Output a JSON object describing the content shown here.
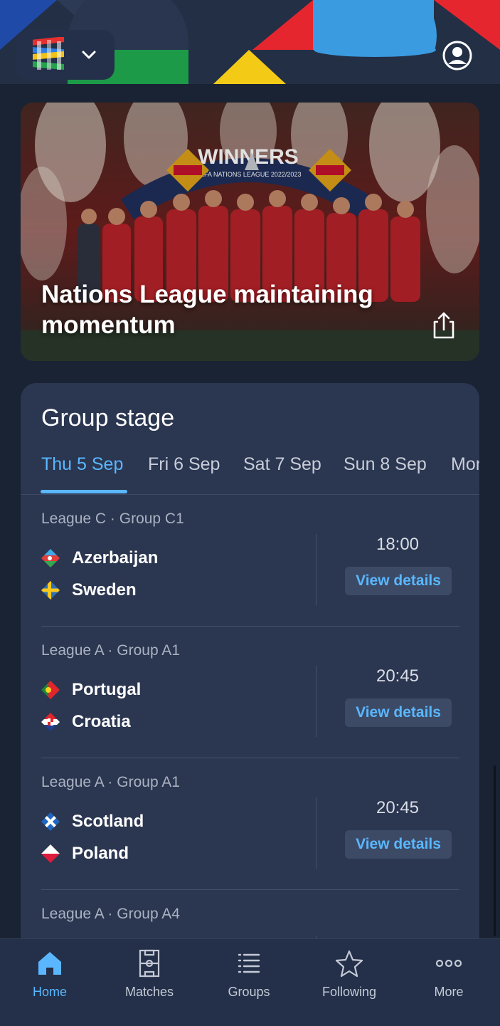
{
  "header": {
    "logo_icon": "nations-league-logo",
    "dropdown_icon": "chevron-down-icon",
    "profile_icon": "user-circle-icon"
  },
  "hero": {
    "title": "Nations League maintaining momentum",
    "banner_text": "WINNERS",
    "banner_subtext": "UEFA NATIONS LEAGUE 2022/2023",
    "share_icon": "share-icon"
  },
  "group_stage": {
    "title": "Group stage",
    "tabs": [
      {
        "label": "Thu 5 Sep",
        "active": true
      },
      {
        "label": "Fri 6 Sep",
        "active": false
      },
      {
        "label": "Sat 7 Sep",
        "active": false
      },
      {
        "label": "Sun 8 Sep",
        "active": false
      },
      {
        "label": "Mon",
        "active": false
      }
    ],
    "matches": [
      {
        "league": "League C · Group C1",
        "home": {
          "name": "Azerbaijan",
          "flag": "azerbaijan-flag"
        },
        "away": {
          "name": "Sweden",
          "flag": "sweden-flag"
        },
        "time": "18:00",
        "details_label": "View details"
      },
      {
        "league": "League A · Group A1",
        "home": {
          "name": "Portugal",
          "flag": "portugal-flag"
        },
        "away": {
          "name": "Croatia",
          "flag": "croatia-flag"
        },
        "time": "20:45",
        "details_label": "View details"
      },
      {
        "league": "League A · Group A1",
        "home": {
          "name": "Scotland",
          "flag": "scotland-flag"
        },
        "away": {
          "name": "Poland",
          "flag": "poland-flag"
        },
        "time": "20:45",
        "details_label": "View details"
      },
      {
        "league": "League A · Group A4"
      }
    ]
  },
  "bottom_nav": [
    {
      "label": "Home",
      "icon": "home-icon",
      "active": true
    },
    {
      "label": "Matches",
      "icon": "pitch-icon",
      "active": false
    },
    {
      "label": "Groups",
      "icon": "list-icon",
      "active": false
    },
    {
      "label": "Following",
      "icon": "star-icon",
      "active": false
    },
    {
      "label": "More",
      "icon": "more-dots-icon",
      "active": false
    }
  ],
  "colors": {
    "background": "#1a2333",
    "card": "#2b3650",
    "accent": "#5ab7ff",
    "nav": "#243049"
  }
}
